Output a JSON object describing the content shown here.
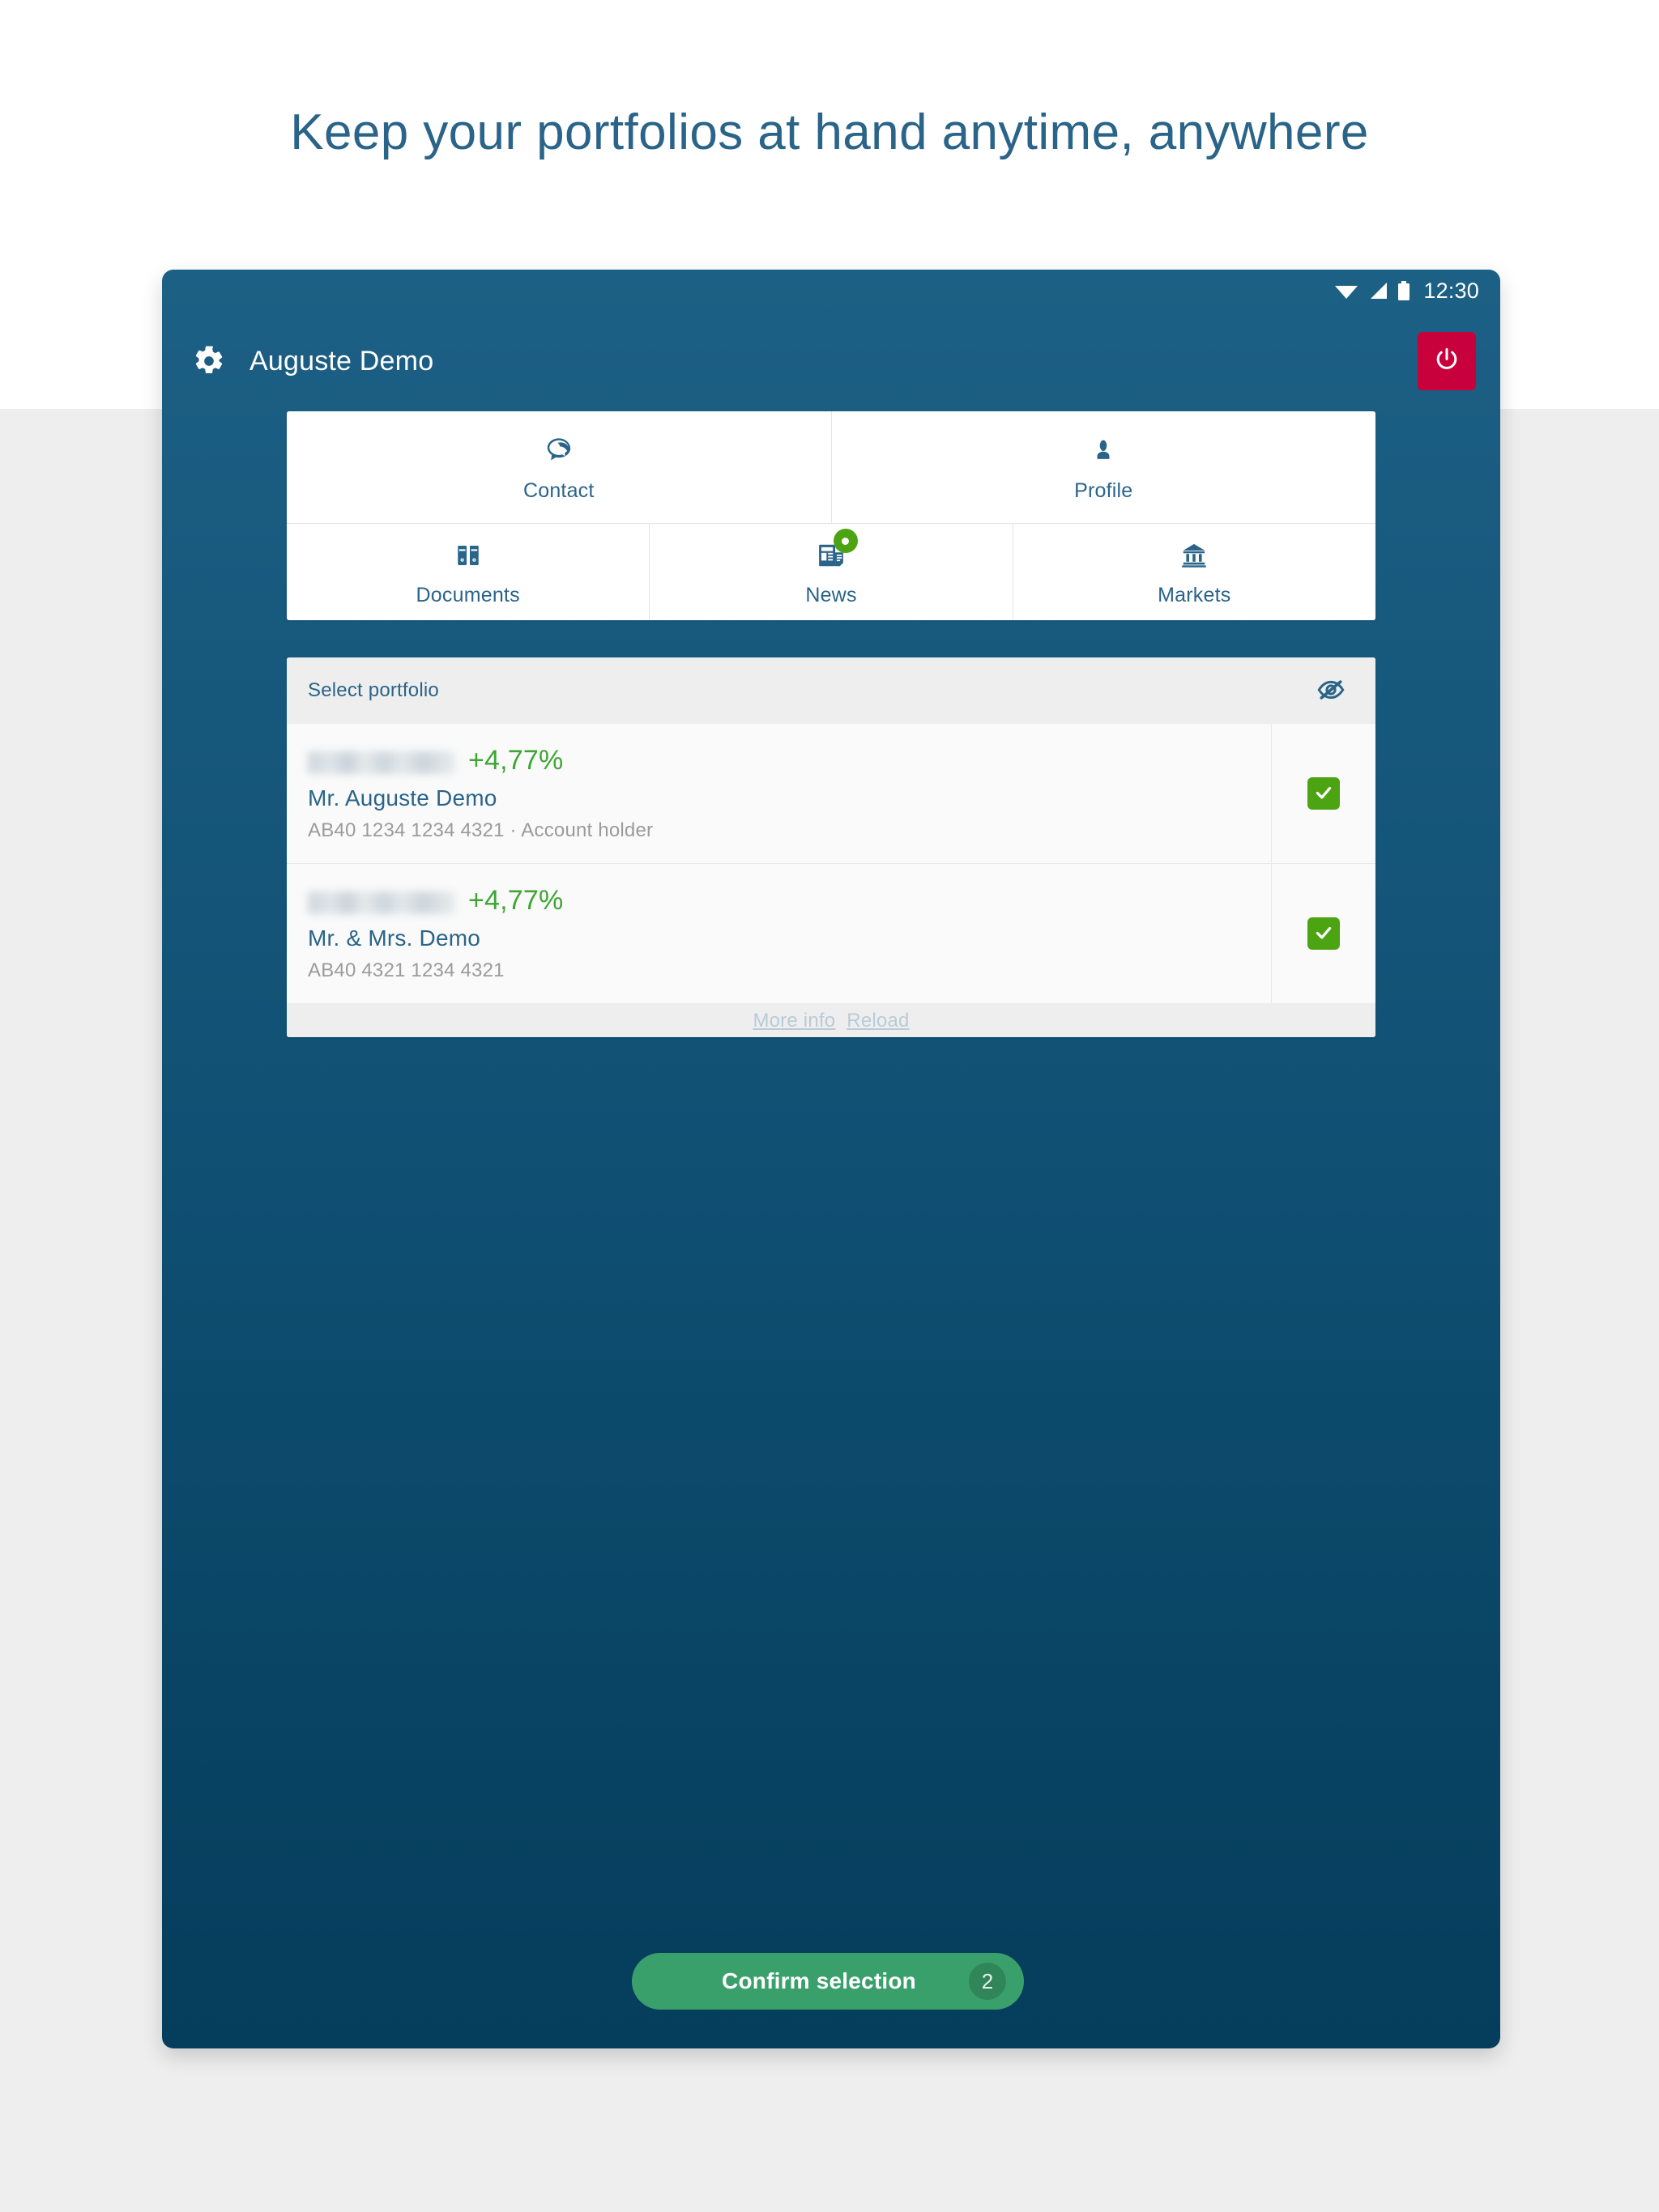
{
  "headline": "Keep your portfolios at hand anytime, anywhere",
  "status_bar": {
    "wifi_icon": "wifi-icon",
    "signal_icon": "cellular-signal-icon",
    "battery_icon": "battery-icon",
    "time": "12:30"
  },
  "app_bar": {
    "gear_icon": "gear-icon",
    "title": "Auguste Demo",
    "logout_icon": "power-icon",
    "logout_color": "#C8003C"
  },
  "tiles": [
    {
      "label": "Contact",
      "icon": "speech-bubble-icon",
      "badge": null
    },
    {
      "label": "Profile",
      "icon": "person-icon",
      "badge": null
    },
    {
      "label": "Documents",
      "icon": "binders-icon",
      "badge": null
    },
    {
      "label": "News",
      "icon": "newspaper-icon",
      "badge": "new-items-dot"
    },
    {
      "label": "Markets",
      "icon": "bank-building-icon",
      "badge": null
    }
  ],
  "portfolio_card": {
    "title": "Select portfolio",
    "visibility_icon": "eye-off-icon",
    "rows": [
      {
        "amount": "",
        "amount_hidden": true,
        "performance": "+4,77%",
        "name": "Mr. Auguste Demo",
        "meta": "AB40 1234 1234 4321 · Account holder",
        "checked": true
      },
      {
        "amount": "",
        "amount_hidden": true,
        "performance": "+4,77%",
        "name": "Mr. & Mrs. Demo",
        "meta": "AB40 4321 1234 4321",
        "checked": true
      }
    ]
  },
  "links": [
    {
      "label": "More info"
    },
    {
      "label": "Reload"
    }
  ],
  "confirm": {
    "label": "Confirm selection",
    "count": "2"
  },
  "colors": {
    "brand_blue": "#2a6489",
    "device_top": "#1d6085",
    "device_bottom": "#053d5c",
    "accent_green": "#4CA413",
    "performance_green": "#3FA535",
    "confirm_green": "#3AA06B",
    "logout_red": "#C8003C"
  }
}
